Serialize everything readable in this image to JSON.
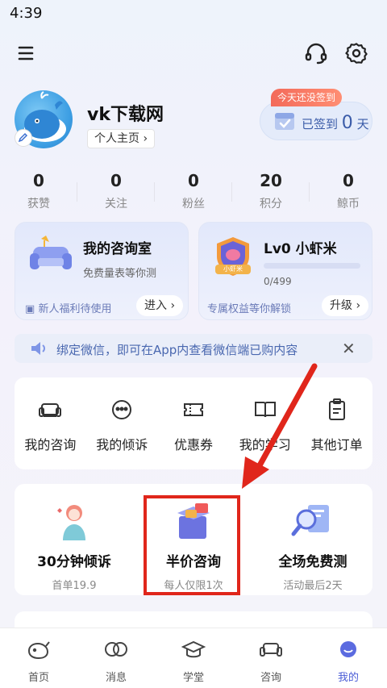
{
  "status": {
    "time": "4:39"
  },
  "profile": {
    "username": "vk下载网",
    "homepage_label": "个人主页 ›"
  },
  "checkin": {
    "tag": "今天还没签到",
    "label": "已签到",
    "days": "0",
    "unit": "天"
  },
  "stats": [
    {
      "value": "0",
      "label": "获赞"
    },
    {
      "value": "0",
      "label": "关注"
    },
    {
      "value": "0",
      "label": "粉丝"
    },
    {
      "value": "20",
      "label": "积分"
    },
    {
      "value": "0",
      "label": "鲸币"
    }
  ],
  "consult_card": {
    "title": "我的咨询室",
    "subtitle": "免费量表等你测",
    "footer": "新人福利待使用",
    "button": "进入 ›"
  },
  "level_card": {
    "badge_text": "小虾米",
    "title": "Lv0 小虾米",
    "progress": "0/499",
    "progress_value": 0,
    "footer": "专属权益等你解锁",
    "button": "升级 ›"
  },
  "wechat_bar": {
    "text": "绑定微信，即可在App内查看微信端已购内容"
  },
  "orders": [
    {
      "label": "我的咨询",
      "icon": "sofa-icon"
    },
    {
      "label": "我的倾诉",
      "icon": "chat-face-icon"
    },
    {
      "label": "优惠券",
      "icon": "ticket-icon"
    },
    {
      "label": "我的学习",
      "icon": "book-icon"
    },
    {
      "label": "其他订单",
      "icon": "clipboard-icon"
    }
  ],
  "services": [
    {
      "title": "30分钟倾诉",
      "subtitle": "首单19.9"
    },
    {
      "title": "半价咨询",
      "subtitle": "每人仅限1次"
    },
    {
      "title": "全场免费测",
      "subtitle": "活动最后2天"
    }
  ],
  "nav": [
    {
      "label": "首页",
      "icon": "whale-icon"
    },
    {
      "label": "消息",
      "icon": "message-icon"
    },
    {
      "label": "学堂",
      "icon": "graduation-cap-icon"
    },
    {
      "label": "咨询",
      "icon": "sofa-icon"
    },
    {
      "label": "我的",
      "icon": "profile-icon",
      "active": true
    }
  ],
  "colors": {
    "accent": "#4a5cd6",
    "highlight": "#e0261b",
    "arrow": "#e0261b"
  }
}
